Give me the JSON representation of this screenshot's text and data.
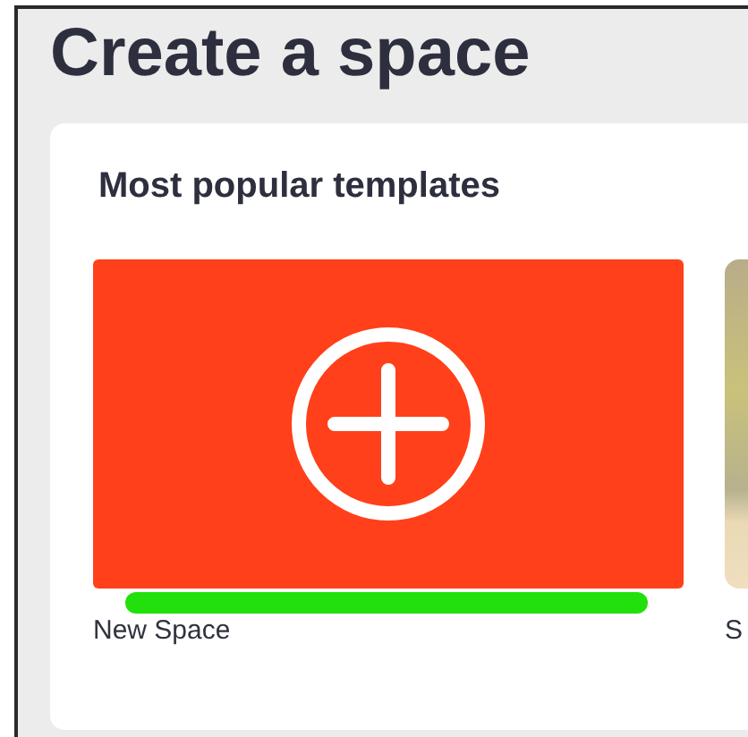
{
  "page": {
    "title": "Create a space"
  },
  "section": {
    "heading": "Most popular templates"
  },
  "templates": [
    {
      "kind": "new",
      "label": "New Space",
      "selected": true
    },
    {
      "kind": "photo",
      "label": "S",
      "selected": false
    }
  ]
}
